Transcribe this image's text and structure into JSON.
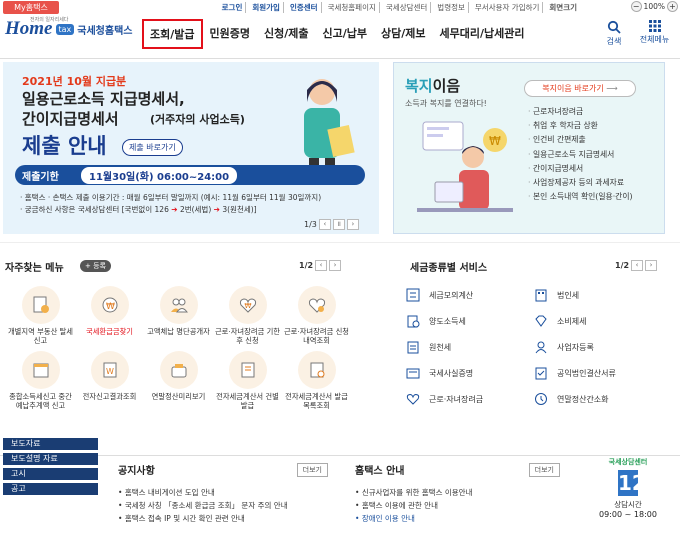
{
  "topbar": {
    "myhometax": "My홈택스",
    "links": [
      "로그인",
      "회원가입",
      "인증센터",
      "국세청홈페이지",
      "국세상담센터",
      "법령정보",
      "무서사용자 가입하기",
      "회면크기"
    ],
    "zoom": "100%"
  },
  "header": {
    "logo_home": "Home",
    "logo_tax": "tax",
    "logo_kr": "국세청홈택스",
    "logo_tagline": "전자의 일자리세다",
    "nav": [
      "조회/발급",
      "민원증명",
      "신청/제출",
      "신고/납부",
      "상담/제보",
      "세무대리/납세관리"
    ],
    "search": "검색",
    "allmenu": "전체메뉴"
  },
  "banner": {
    "date": "2021년 10월 지급분",
    "title1": "일용근로소득 지급명세서,",
    "title2": "간이지급명세서",
    "title2_sub": "(거주자의 사업소득)",
    "submit": "제출 안내",
    "quick": "제출 바로가기",
    "deadline_label": "제출기한",
    "deadline": "11월30일(화) 06:00~24:00",
    "note1": "· 홈택스 · 손택스 제출 이용기간 : 매월 6일부터 말일까지 (예시: 11월 6일부터 11월 30일까지)",
    "note2a": "· 궁금하신 사항은 국세상담센터 [국번없이 126",
    "note2b": "2번(세법)",
    "note2c": "3(원천세)]",
    "page": "1/3"
  },
  "welfare": {
    "title_a": "복지",
    "title_b": "이음",
    "desc": "소득과 복지를 연결하다!",
    "button": "복지이음 바로가기",
    "items": [
      "근로자녀장려금",
      "취업 후 학자금 상환",
      "인건비 간편제출",
      "일용근로소득 지급명세서",
      "간이지급명세서",
      "사업장제공자 등의 과세자료",
      "본인 소득내역 확인(일용·간이)"
    ]
  },
  "favorites": {
    "title": "자주찾는 메뉴",
    "register": "+ 등록",
    "page": "1/2",
    "items": [
      "개별지역 부동산 탈세신고",
      "국세환급금찾기",
      "고액체납 명단공개자",
      "근로·자녀장려금 기한후 신청",
      "근로·자녀장려금 신청내역조회",
      "종합소득세신고 중간예납추계액 신고",
      "전자신고결과조회",
      "연말정산미리보기",
      "전자세금계산서 건별발급",
      "전자세금계산서 발급목록조회"
    ]
  },
  "services": {
    "title": "세금종류별 서비스",
    "page": "1/2",
    "items": [
      "세금모의계산",
      "법인세",
      "양도소득세",
      "소비제세",
      "원천세",
      "사업자등록",
      "국세사실증명",
      "공익법인결산서류",
      "근로·자녀장려금",
      "연말정산간소화"
    ]
  },
  "bottom_nav": [
    "보도자료",
    "보도설명 자료",
    "고시",
    "공고"
  ],
  "notice": {
    "title": "공지사항",
    "more": "더보기",
    "items": [
      "홈택스 내비게이션 도입 안내",
      "국세청 사칭 「종소세 환급금 조회」 문자 주의 안내",
      "홈택스 접속 IP 및 시간 확인 관련 안내"
    ]
  },
  "hometax_info": {
    "title": "홈택스 안내",
    "more": "더보기",
    "items": [
      "신규사업자를 위한 홈택스 이용안내",
      "홈택스 이용에 관한 안내",
      "장애인 이용 안내"
    ]
  },
  "callcenter": {
    "label": "국세상담센터",
    "number": "126",
    "hours_label": "상담시간",
    "hours": "09:00 ~ 18:00"
  }
}
